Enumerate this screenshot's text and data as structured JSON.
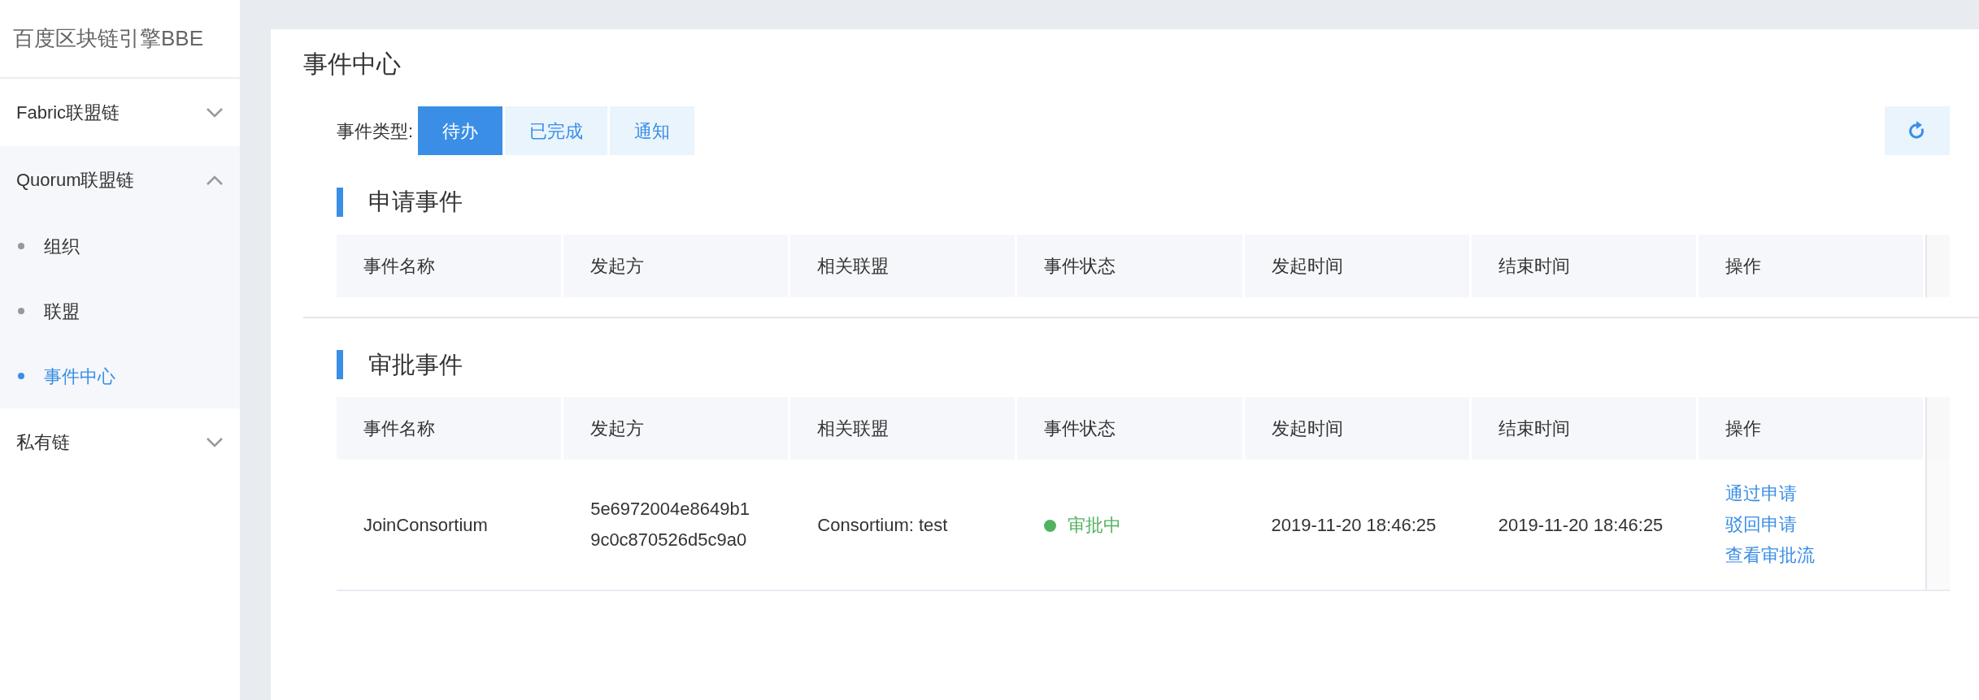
{
  "sidebar": {
    "title": "百度区块链引擎BBE",
    "items": [
      {
        "label": "Fabric联盟链",
        "expanded": false
      },
      {
        "label": "Quorum联盟链",
        "expanded": true,
        "children": [
          {
            "label": "组织",
            "selected": false
          },
          {
            "label": "联盟",
            "selected": false
          },
          {
            "label": "事件中心",
            "selected": true
          }
        ]
      },
      {
        "label": "私有链",
        "expanded": false
      }
    ]
  },
  "page": {
    "title": "事件中心"
  },
  "filter": {
    "label": "事件类型:",
    "options": [
      {
        "label": "待办",
        "selected": true
      },
      {
        "label": "已完成",
        "selected": false
      },
      {
        "label": "通知",
        "selected": false
      }
    ]
  },
  "sections": [
    {
      "title": "申请事件",
      "columns": [
        "事件名称",
        "发起方",
        "相关联盟",
        "事件状态",
        "发起时间",
        "结束时间",
        "操作"
      ]
    },
    {
      "title": "审批事件",
      "columns": [
        "事件名称",
        "发起方",
        "相关联盟",
        "事件状态",
        "发起时间",
        "结束时间",
        "操作"
      ],
      "rows": [
        {
          "name": "JoinConsortium",
          "initiator": "5e6972004e8649b19c0c870526d5c9a0",
          "consortium": "Consortium: test",
          "status": {
            "text": "审批中",
            "color": "#52b35e"
          },
          "start": "2019-11-20 18:46:25",
          "end": "2019-11-20 18:46:25",
          "actions": [
            "通过申请",
            "驳回申请",
            "查看审批流"
          ]
        }
      ]
    }
  ]
}
